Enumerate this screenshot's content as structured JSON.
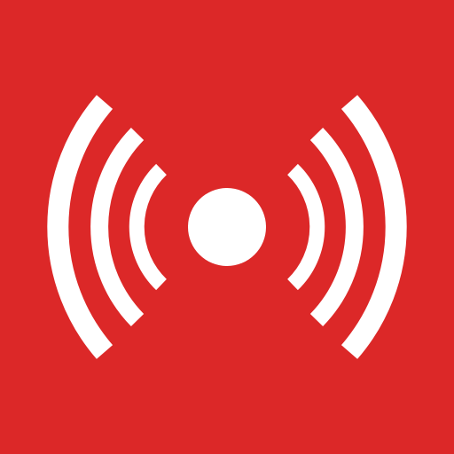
{
  "icon": {
    "name": "broadcast-signal-icon",
    "background_color": "#DC2828",
    "foreground_color": "#FFFFFF"
  }
}
